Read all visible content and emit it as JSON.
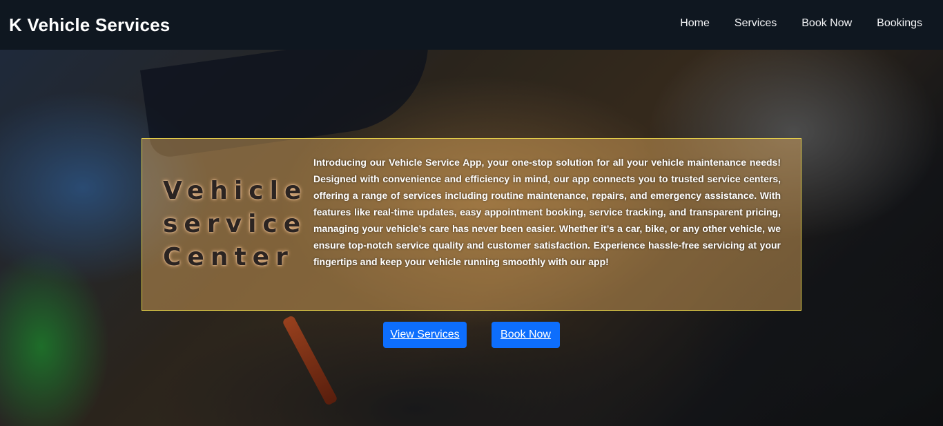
{
  "navbar": {
    "brand": "K Vehicle Services",
    "links": [
      {
        "label": "Home"
      },
      {
        "label": "Services"
      },
      {
        "label": "Book Now"
      },
      {
        "label": "Bookings"
      }
    ]
  },
  "hero": {
    "background_image": "mechanic-engine-repair-photo",
    "title": "Vehicle service Center",
    "description": "Introducing our Vehicle Service App, your one-stop solution for all your vehicle maintenance needs! Designed with convenience and efficiency in mind, our app connects you to trusted service centers, offering a range of services including routine maintenance, repairs, and emergency assistance. With features like real-time updates, easy appointment booking, service tracking, and transparent pricing, managing your vehicle’s care has never been easier. Whether it’s a car, bike, or any other vehicle, we ensure top-notch service quality and customer satisfaction. Experience hassle-free servicing at your fingertips and keep your vehicle running smoothly with our app!",
    "buttons": {
      "view_services": "View Services",
      "book_now": "Book Now"
    }
  },
  "colors": {
    "navbar_bg": "#0f1720",
    "accent": "#0d6efd",
    "box_border": "#e8d24a"
  }
}
